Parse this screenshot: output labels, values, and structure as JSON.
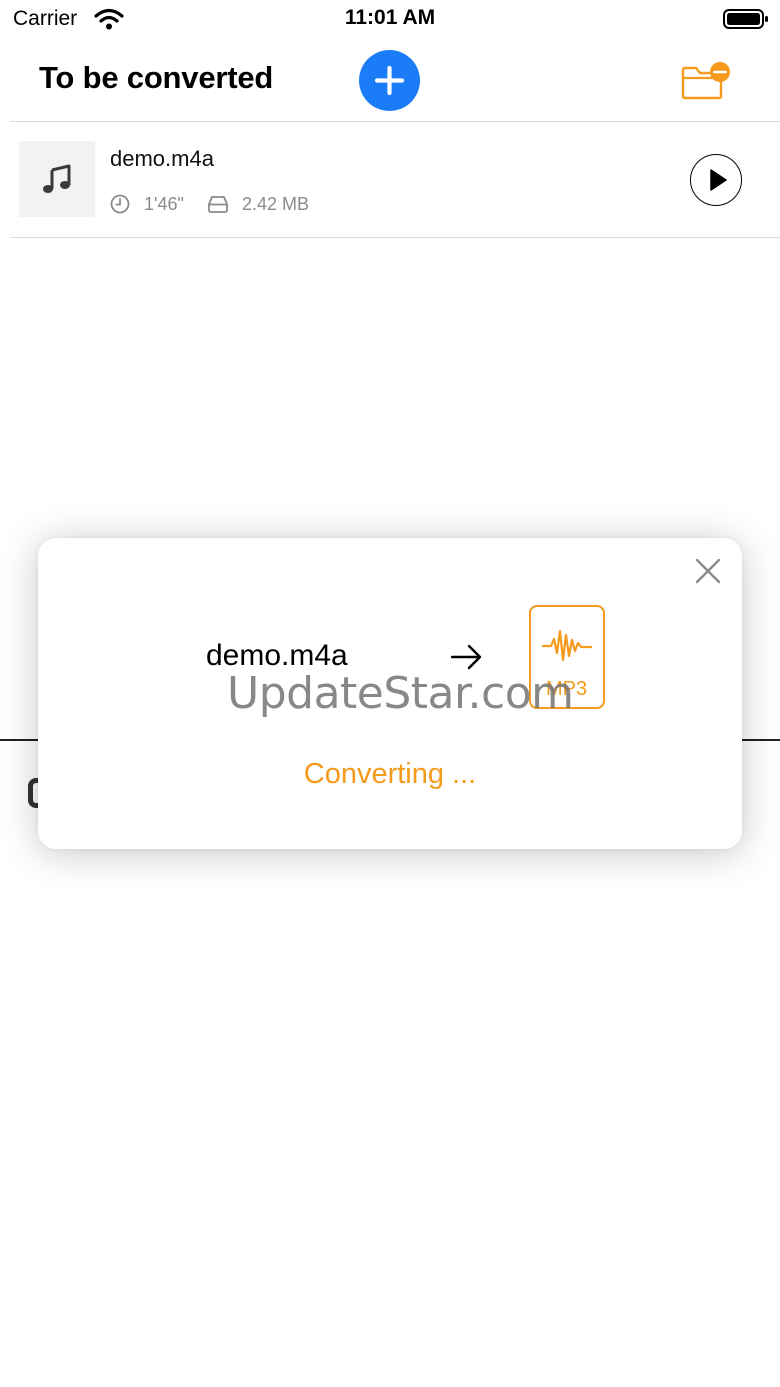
{
  "status_bar": {
    "carrier": "Carrier",
    "time": "11:01 AM"
  },
  "header": {
    "title": "To be converted"
  },
  "file_list": [
    {
      "name": "demo.m4a",
      "duration": "1'46\"",
      "size": "2.42 MB"
    }
  ],
  "dialog": {
    "source_name": "demo.m4a",
    "target_format": "MP3",
    "status": "Converting ..."
  },
  "watermark": "UpdateStar.com",
  "colors": {
    "accent_blue": "#1a7cf7",
    "accent_orange": "#f49a1c",
    "meta_gray": "#8a8a8e",
    "thumb_bg": "#f2f2f4"
  },
  "icons": {
    "add": "plus-icon",
    "folder": "folder-minus-icon",
    "file": "music-note-icon",
    "duration": "clock-icon",
    "size": "drive-icon",
    "play": "play-icon",
    "close": "close-icon",
    "arrow": "arrow-right-icon",
    "format": "mp3-file-icon"
  }
}
